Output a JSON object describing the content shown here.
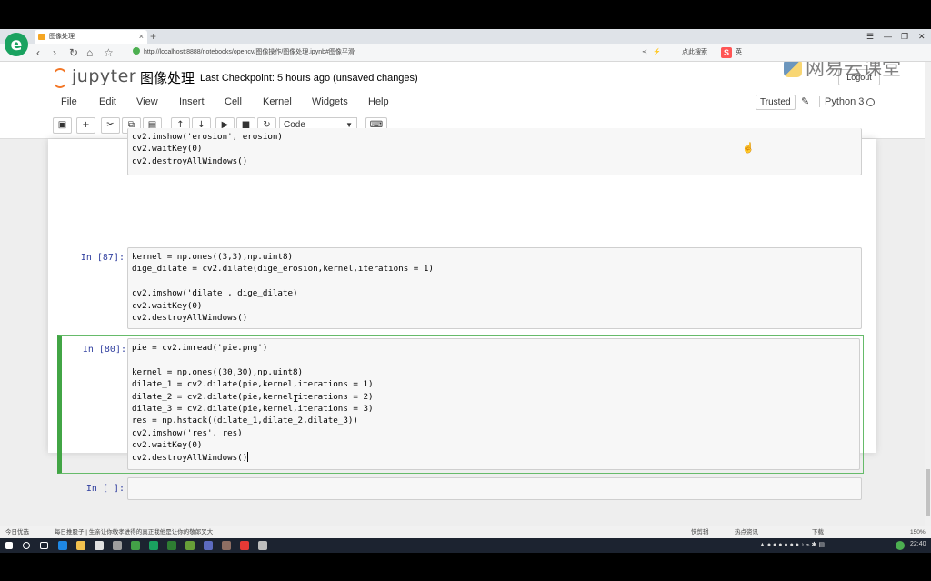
{
  "browser": {
    "tab_title": "图像处理",
    "tab_close": "×",
    "new_tab": "+",
    "url": "http://localhost:8888/notebooks/opencv/图像操作/图像处理.ipynb#图像平滑",
    "search_hint": "点此搜索",
    "sogou_label": "S",
    "ime_label": "英",
    "status_left": "今日优选",
    "status_news": "每日推股子 | 生亲让你敬孝进得的真正我他是让你的敬郎叉大",
    "status_right_1": "快剪辑",
    "status_right_2": "热点资讯",
    "status_right_3": "下载",
    "zoom": "150%"
  },
  "jupyter": {
    "logo_text": "jupyter",
    "notebook_name": "图像处理",
    "checkpoint": "Last Checkpoint: 5 hours ago (unsaved changes)",
    "logout": "Logout",
    "trusted": "Trusted",
    "kernel": "Python 3",
    "cell_type": "Code",
    "menu": [
      "File",
      "Edit",
      "View",
      "Insert",
      "Cell",
      "Kernel",
      "Widgets",
      "Help"
    ]
  },
  "watermark": "网易云课堂",
  "cells": [
    {
      "prompt": "",
      "lines": [
        "cv2.imshow('erosion', erosion)",
        "cv2.waitKey(0)",
        "cv2.destroyAllWindows()"
      ]
    },
    {
      "prompt": "In [87]:",
      "lines": [
        "kernel = np.ones((3,3),np.uint8)",
        "dige_dilate = cv2.dilate(dige_erosion,kernel,iterations = 1)",
        "",
        "cv2.imshow('dilate', dige_dilate)",
        "cv2.waitKey(0)",
        "cv2.destroyAllWindows()"
      ]
    },
    {
      "prompt": "In [80]:",
      "lines": [
        "pie = cv2.imread('pie.png')",
        "",
        "kernel = np.ones((30,30),np.uint8)",
        "dilate_1 = cv2.dilate(pie,kernel,iterations = 1)",
        "dilate_2 = cv2.dilate(pie,kernel,iterations = 2)",
        "dilate_3 = cv2.dilate(pie,kernel,iterations = 3)",
        "res = np.hstack((dilate_1,dilate_2,dilate_3))",
        "cv2.imshow('res', res)",
        "cv2.waitKey(0)",
        "cv2.destroyAllWindows()"
      ]
    },
    {
      "prompt": "In [ ]:",
      "lines": [
        ""
      ]
    }
  ],
  "clock": "22:40",
  "colors": {
    "selected_border": "#42a545",
    "prompt_in": "#303f9f",
    "string": "#ba2121"
  }
}
